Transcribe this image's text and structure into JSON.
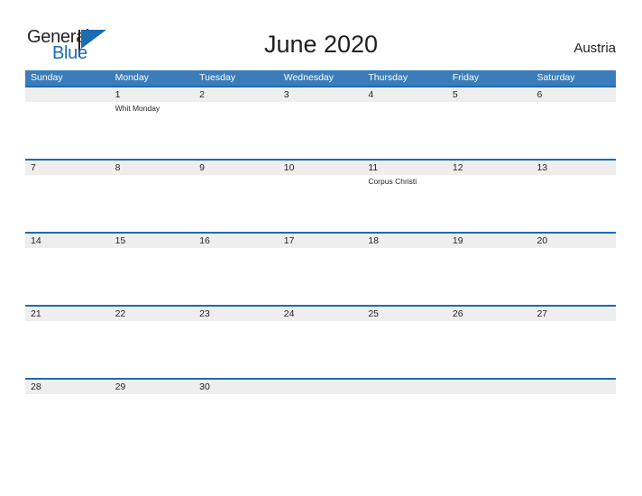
{
  "brand": {
    "word_one": "General",
    "word_two": "Blue",
    "triangle_icon": "brand-triangle-icon",
    "accent_color": "#1b6cb0"
  },
  "header": {
    "title": "June 2020",
    "country": "Austria"
  },
  "colors": {
    "header_blue": "#3b7cba",
    "rule_blue": "#1b6cb0",
    "band_gray": "#eeeeee",
    "text": "#231f20",
    "page_background": "#ffffff"
  },
  "calendar": {
    "month": "June",
    "year": "2020",
    "weekday_headers": [
      "Sunday",
      "Monday",
      "Tuesday",
      "Wednesday",
      "Thursday",
      "Friday",
      "Saturday"
    ],
    "weeks": [
      [
        {
          "date": "",
          "event": ""
        },
        {
          "date": "1",
          "event": "Whit Monday"
        },
        {
          "date": "2",
          "event": ""
        },
        {
          "date": "3",
          "event": ""
        },
        {
          "date": "4",
          "event": ""
        },
        {
          "date": "5",
          "event": ""
        },
        {
          "date": "6",
          "event": ""
        }
      ],
      [
        {
          "date": "7",
          "event": ""
        },
        {
          "date": "8",
          "event": ""
        },
        {
          "date": "9",
          "event": ""
        },
        {
          "date": "10",
          "event": ""
        },
        {
          "date": "11",
          "event": "Corpus Christi"
        },
        {
          "date": "12",
          "event": ""
        },
        {
          "date": "13",
          "event": ""
        }
      ],
      [
        {
          "date": "14",
          "event": ""
        },
        {
          "date": "15",
          "event": ""
        },
        {
          "date": "16",
          "event": ""
        },
        {
          "date": "17",
          "event": ""
        },
        {
          "date": "18",
          "event": ""
        },
        {
          "date": "19",
          "event": ""
        },
        {
          "date": "20",
          "event": ""
        }
      ],
      [
        {
          "date": "21",
          "event": ""
        },
        {
          "date": "22",
          "event": ""
        },
        {
          "date": "23",
          "event": ""
        },
        {
          "date": "24",
          "event": ""
        },
        {
          "date": "25",
          "event": ""
        },
        {
          "date": "26",
          "event": ""
        },
        {
          "date": "27",
          "event": ""
        }
      ],
      [
        {
          "date": "28",
          "event": ""
        },
        {
          "date": "29",
          "event": ""
        },
        {
          "date": "30",
          "event": ""
        },
        {
          "date": "",
          "event": ""
        },
        {
          "date": "",
          "event": ""
        },
        {
          "date": "",
          "event": ""
        },
        {
          "date": "",
          "event": ""
        }
      ]
    ]
  }
}
